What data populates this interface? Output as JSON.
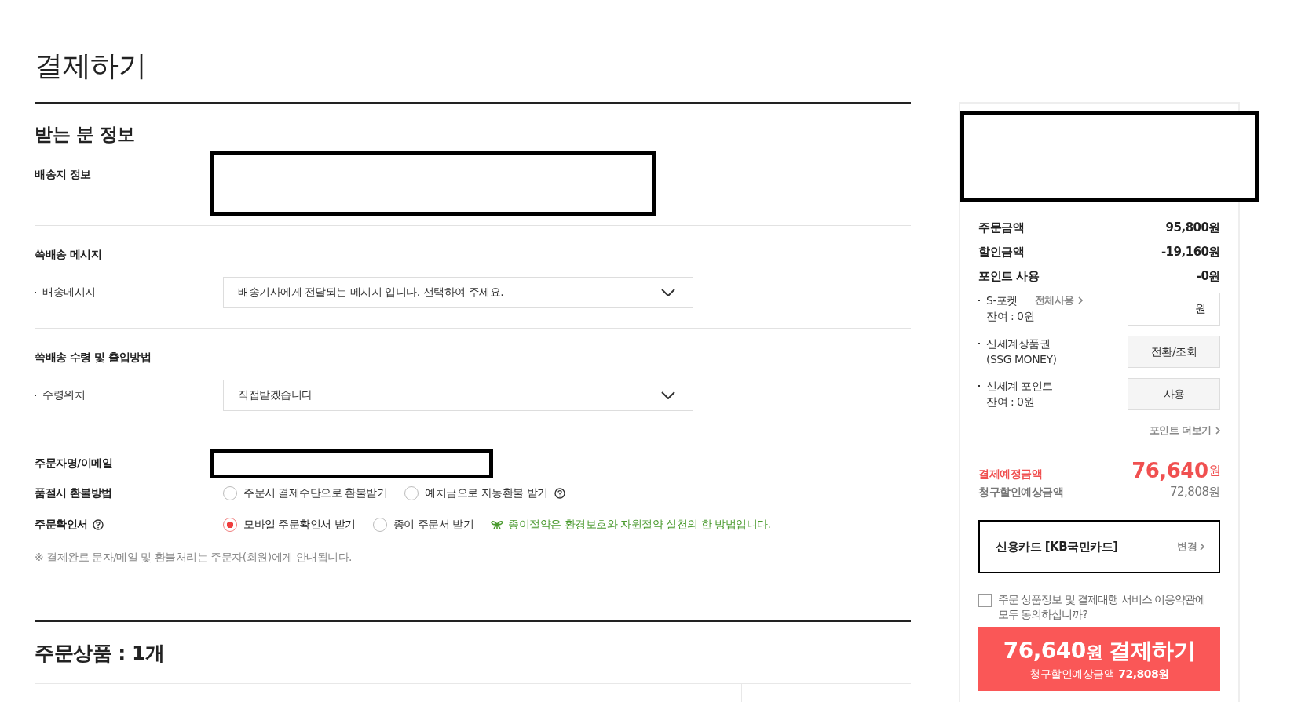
{
  "page_title": "결제하기",
  "recipient": {
    "title": "받는 분 정보",
    "address_label": "배송지 정보"
  },
  "sections": [
    {
      "title": "쓱배송 메시지",
      "label": "배송메시지",
      "select_value": "배송기사에게 전달되는 메시지 입니다. 선택하여 주세요."
    },
    {
      "title": "쓱배송 수령 및 출입방법",
      "label": "수령위치",
      "select_value": "직접받겠습니다"
    }
  ],
  "orderer": {
    "label": "주문자명/이메일"
  },
  "refund": {
    "label": "품절시 환불방법",
    "options": [
      {
        "label": "주문시 결제수단으로 환불받기",
        "selected": false,
        "help_icon": false
      },
      {
        "label": "예치금으로 자동환불 받기",
        "selected": false,
        "help_icon": true
      }
    ]
  },
  "confirmation": {
    "label": "주문확인서",
    "help_icon": true,
    "options": [
      {
        "label": "모바일 주문확인서 받기",
        "selected": true,
        "help_icon": false
      },
      {
        "label": "종이 주문서 받기",
        "selected": false,
        "help_icon": false
      }
    ],
    "eco_note": "종이절약은 환경보호와 자원절약 실천의 한 방법입니다."
  },
  "note": "※ 결제완료 문자/메일 및 환불처리는 주문자(회원)에게 안내됩니다.",
  "order_items": {
    "title": "주문상품 : 1개"
  },
  "summary": {
    "rows": [
      {
        "label": "주문금액",
        "value": "95,800원"
      },
      {
        "label": "할인금액",
        "value": "-19,160원"
      },
      {
        "label": "포인트 사용",
        "value": "-0원"
      }
    ],
    "points": [
      {
        "kind": "field",
        "name": "S-포켓",
        "link": "전체사용",
        "sub": "잔여 : 0원",
        "unit": "원"
      },
      {
        "kind": "button",
        "name": "신세계상품권",
        "sub": "(SSG MONEY)",
        "button": "전환/조회"
      },
      {
        "kind": "button",
        "name": "신세계 포인트",
        "sub": "잔여 : 0원",
        "button": "사용"
      }
    ],
    "more_link": "포인트 더보기",
    "total": {
      "label": "결제예정금액",
      "amount": "76,640",
      "unit": "원"
    },
    "card_discount": {
      "label": "청구할인예상금액",
      "value": "72,808원"
    },
    "payment_method": {
      "label": "신용카드 [KB국민카드]",
      "change": "변경"
    },
    "agree": {
      "text": "주문 상품정보 및 결제대행 서비스 이용약관에 모두 동의하십니까?",
      "checked": false
    },
    "pay_button": {
      "amount": "76,640",
      "unit": "원",
      "action": "결제하기",
      "sub_label": "청구할인예상금액",
      "sub_value": "72,808원"
    }
  }
}
